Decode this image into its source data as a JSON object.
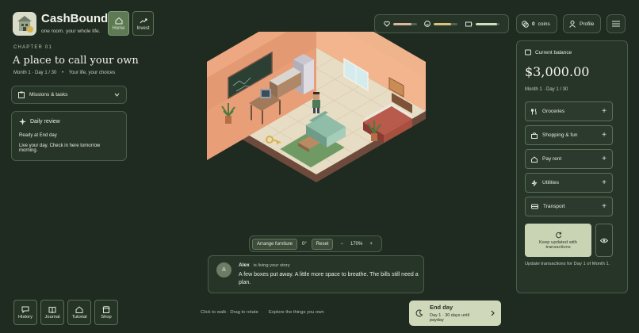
{
  "brand": {
    "name": "CashBound",
    "tagline": "one room. your whole life."
  },
  "nav": [
    {
      "label": "Home",
      "icon": "home-icon",
      "active": true
    },
    {
      "label": "Invest",
      "icon": "trend-up-icon",
      "active": false
    }
  ],
  "chapter": {
    "eyebrow": "CHAPTER 01",
    "title": "A place to call your own",
    "date": "Month 1 · Day 1 / 30",
    "separator": "•",
    "motto": "Your life, your choices"
  },
  "missions": {
    "label": "Missions & tasks"
  },
  "review": {
    "title": "Daily review",
    "line1": "Ready at End day",
    "line2": "Live your day. Check in here tomorrow morning."
  },
  "status": {
    "health": 0.78,
    "happiness": 0.72,
    "energy": 0.88,
    "colors": {
      "health": "#d9b7a1",
      "happiness": "#d9c27a",
      "energy": "#cfe0b9"
    }
  },
  "coins": {
    "count": "0",
    "unit": "coins"
  },
  "profile": {
    "label": "Profile"
  },
  "balance": {
    "label": "Current balance",
    "amount": "$3,000.00",
    "date": "Month 1 · Day 1 / 30"
  },
  "actions": [
    {
      "label": "Groceries",
      "icon": "utensils-icon"
    },
    {
      "label": "Shopping & fun",
      "icon": "shopping-bag-icon"
    },
    {
      "label": "Pay rent",
      "icon": "house-icon"
    },
    {
      "label": "Utilities",
      "icon": "bolt-icon"
    },
    {
      "label": "Transport",
      "icon": "bus-icon"
    }
  ],
  "keep_updated": {
    "label": "Keep updated with transactions"
  },
  "update_note": "Update transactions for Day 1 of Month 1.",
  "arrange": {
    "arrange_label": "Arrange furniture",
    "rotation": "0°",
    "reset_label": "Reset",
    "zoom_out": "−",
    "zoom": "170%",
    "zoom_in": "+"
  },
  "story": {
    "initial": "A",
    "name": "Alex",
    "status": "is living your story",
    "text": "A few boxes put away. A little more space to breathe. The bills still need a plan."
  },
  "tools": [
    {
      "label": "History",
      "icon": "chat-icon"
    },
    {
      "label": "Journal",
      "icon": "book-icon"
    },
    {
      "label": "Tutorial",
      "icon": "home-icon"
    },
    {
      "label": "Shop",
      "icon": "store-icon"
    }
  ],
  "hints": {
    "left": "Click to walk · Drag to rotate",
    "right": "Explore the things you own"
  },
  "end_day": {
    "title": "End day",
    "sub": "Day 1 · 30 days until payday"
  }
}
